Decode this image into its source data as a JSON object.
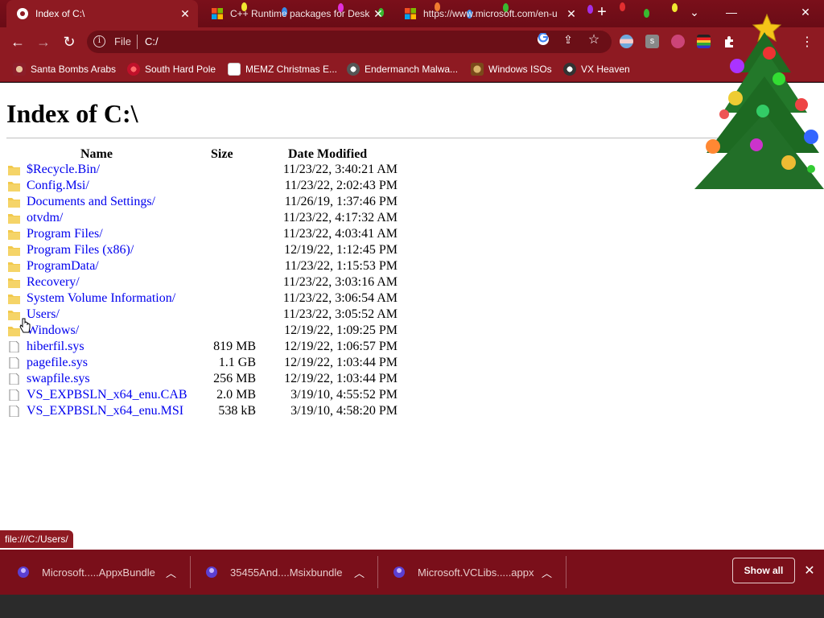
{
  "browser": {
    "tabs": [
      {
        "title": "Index of C:\\",
        "active": true
      },
      {
        "title": "C++ Runtime packages for Desk",
        "active": false
      },
      {
        "title": "https://www.microsoft.com/en-u",
        "active": false
      }
    ],
    "scheme_label": "File",
    "url": "C:/",
    "bookmarks": [
      {
        "label": "Santa Bombs Arabs"
      },
      {
        "label": "South Hard Pole"
      },
      {
        "label": "MEMZ Christmas E..."
      },
      {
        "label": "Endermanch Malwa..."
      },
      {
        "label": "Windows ISOs"
      },
      {
        "label": "VX Heaven"
      }
    ],
    "status_url": "file:///C:/Users/",
    "theme_color": "#8e1a22"
  },
  "page": {
    "title": "Index of C:\\",
    "headers": {
      "name": "Name",
      "size": "Size",
      "date": "Date Modified"
    },
    "entries": [
      {
        "name": "$Recycle.Bin/",
        "size": "",
        "date": "11/23/22, 3:40:21 AM",
        "type": "folder"
      },
      {
        "name": "Config.Msi/",
        "size": "",
        "date": "11/23/22, 2:02:43 PM",
        "type": "folder"
      },
      {
        "name": "Documents and Settings/",
        "size": "",
        "date": "11/26/19, 1:37:46 PM",
        "type": "folder"
      },
      {
        "name": "otvdm/",
        "size": "",
        "date": "11/23/22, 4:17:32 AM",
        "type": "folder"
      },
      {
        "name": "Program Files/",
        "size": "",
        "date": "11/23/22, 4:03:41 AM",
        "type": "folder"
      },
      {
        "name": "Program Files (x86)/",
        "size": "",
        "date": "12/19/22, 1:12:45 PM",
        "type": "folder"
      },
      {
        "name": "ProgramData/",
        "size": "",
        "date": "11/23/22, 1:15:53 PM",
        "type": "folder"
      },
      {
        "name": "Recovery/",
        "size": "",
        "date": "11/23/22, 3:03:16 AM",
        "type": "folder"
      },
      {
        "name": "System Volume Information/",
        "size": "",
        "date": "11/23/22, 3:06:54 AM",
        "type": "folder"
      },
      {
        "name": "Users/",
        "size": "",
        "date": "11/23/22, 3:05:52 AM",
        "type": "folder"
      },
      {
        "name": "Windows/",
        "size": "",
        "date": "12/19/22, 1:09:25 PM",
        "type": "folder"
      },
      {
        "name": "hiberfil.sys",
        "size": "819 MB",
        "date": "12/19/22, 1:06:57 PM",
        "type": "file"
      },
      {
        "name": "pagefile.sys",
        "size": "1.1 GB",
        "date": "12/19/22, 1:03:44 PM",
        "type": "file"
      },
      {
        "name": "swapfile.sys",
        "size": "256 MB",
        "date": "12/19/22, 1:03:44 PM",
        "type": "file"
      },
      {
        "name": "VS_EXPBSLN_x64_enu.CAB",
        "size": "2.0 MB",
        "date": "3/19/10, 4:55:52 PM",
        "type": "file"
      },
      {
        "name": "VS_EXPBSLN_x64_enu.MSI",
        "size": "538 kB",
        "date": "3/19/10, 4:58:20 PM",
        "type": "file"
      }
    ]
  },
  "downloads": {
    "items": [
      {
        "filename": "Microsoft.....AppxBundle"
      },
      {
        "filename": "35455And....Msixbundle"
      },
      {
        "filename": "Microsoft.VCLibs.....appx"
      }
    ],
    "show_all_label": "Show all"
  }
}
